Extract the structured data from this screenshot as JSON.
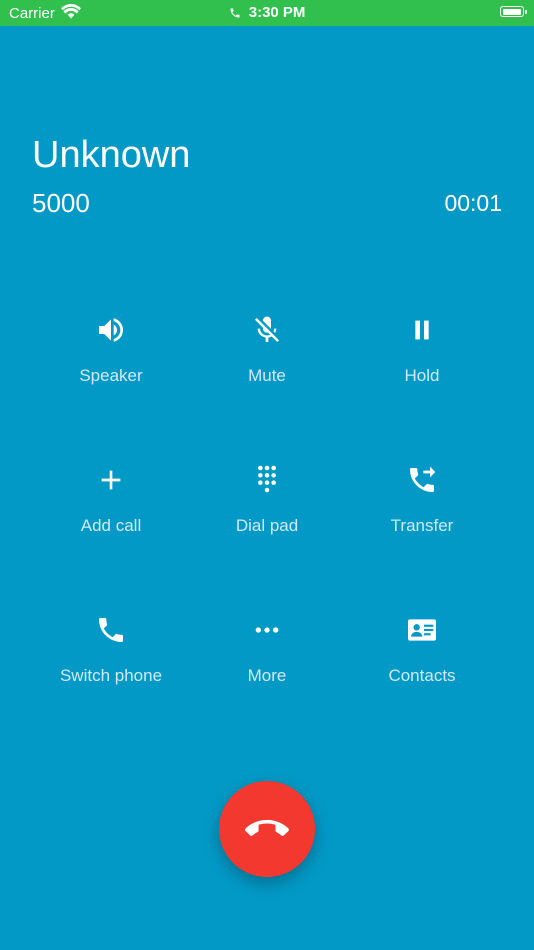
{
  "status_bar": {
    "carrier": "Carrier",
    "time": "3:30 PM",
    "battery_level": 1.0
  },
  "call": {
    "name": "Unknown",
    "number": "5000",
    "duration": "00:01"
  },
  "actions": [
    {
      "label": "Speaker",
      "icon": "speaker-icon"
    },
    {
      "label": "Mute",
      "icon": "mute-icon"
    },
    {
      "label": "Hold",
      "icon": "pause-icon"
    },
    {
      "label": "Add call",
      "icon": "plus-icon"
    },
    {
      "label": "Dial pad",
      "icon": "dialpad-icon"
    },
    {
      "label": "Transfer",
      "icon": "transfer-icon"
    },
    {
      "label": "Switch phone",
      "icon": "phone-icon"
    },
    {
      "label": "More",
      "icon": "more-icon"
    },
    {
      "label": "Contacts",
      "icon": "contact-card-icon"
    }
  ],
  "end_call": {
    "icon": "hang-up-icon"
  },
  "colors": {
    "background": "#0399c6",
    "status_bar": "#31c04e",
    "end_call": "#f3392f",
    "label": "#cfeaf4"
  }
}
